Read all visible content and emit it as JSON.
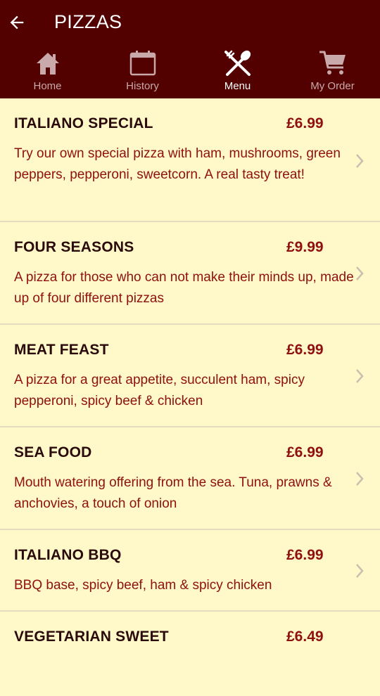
{
  "appbar": {
    "title": "PIZZAS",
    "back_icon": "arrow-left-icon"
  },
  "tabs": [
    {
      "label": "Home",
      "icon": "home-icon",
      "active": false
    },
    {
      "label": "History",
      "icon": "calendar-icon",
      "active": false
    },
    {
      "label": "Menu",
      "icon": "fork-spoon-icon",
      "active": true
    },
    {
      "label": "My Order",
      "icon": "cart-icon",
      "active": false
    }
  ],
  "menu": {
    "items": [
      {
        "name": "ITALIANO SPECIAL",
        "price": "£6.99",
        "description": "Try our own special pizza with ham, mushrooms, green peppers, pepperoni, sweetcorn. A real tasty treat!"
      },
      {
        "name": "FOUR SEASONS",
        "price": "£9.99",
        "description": "A pizza for those who can not make their minds up, made up of four different pizzas"
      },
      {
        "name": "MEAT FEAST",
        "price": "£6.99",
        "description": "A pizza for a great appetite, succulent ham, spicy pepperoni, spicy beef & chicken"
      },
      {
        "name": "SEA FOOD",
        "price": "£6.99",
        "description": "Mouth watering offering from the sea. Tuna, prawns & anchovies, a touch of onion"
      },
      {
        "name": "ITALIANO BBQ",
        "price": "£6.99",
        "description": "BBQ base, spicy beef, ham & spicy chicken"
      },
      {
        "name": "VEGETARIAN SWEET",
        "price": "£6.49",
        "description": ""
      }
    ]
  },
  "colors": {
    "bar": "#520000",
    "background": "#fff8c8",
    "accent": "#8f1010"
  }
}
